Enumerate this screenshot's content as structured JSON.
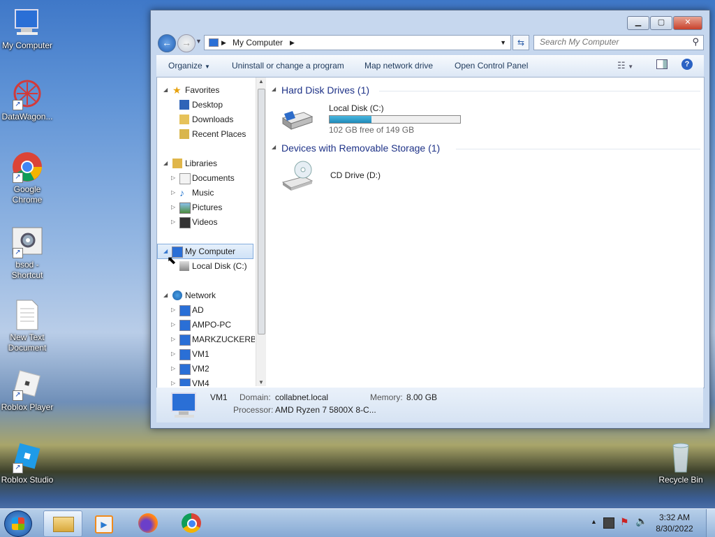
{
  "desktop": {
    "icons": [
      {
        "label": "My Computer"
      },
      {
        "label": "DataWagon..."
      },
      {
        "label": "Google Chrome"
      },
      {
        "label": "bsod - Shortcut"
      },
      {
        "label": "New Text Document"
      },
      {
        "label": "Roblox Player"
      },
      {
        "label": "Roblox Studio"
      },
      {
        "label": "Recycle Bin"
      }
    ]
  },
  "window": {
    "address": "My Computer",
    "search_placeholder": "Search My Computer",
    "toolbar": {
      "organize": "Organize",
      "uninstall": "Uninstall or change a program",
      "map_drive": "Map network drive",
      "control_panel": "Open Control Panel"
    },
    "nav": {
      "favorites": "Favorites",
      "desktop": "Desktop",
      "downloads": "Downloads",
      "recent": "Recent Places",
      "libraries": "Libraries",
      "documents": "Documents",
      "music": "Music",
      "pictures": "Pictures",
      "videos": "Videos",
      "my_computer": "My Computer",
      "local_disk": "Local Disk (C:)",
      "network": "Network",
      "net_items": [
        "AD",
        "AMPO-PC",
        "MARKZUCKERBE",
        "VM1",
        "VM2",
        "VM4"
      ]
    },
    "groups": {
      "hdd": "Hard Disk Drives (1)",
      "removable": "Devices with Removable Storage (1)"
    },
    "drives": {
      "c_name": "Local Disk (C:)",
      "c_free": "102 GB free of 149 GB",
      "c_used_fraction": 0.32,
      "d_name": "CD Drive (D:)"
    },
    "details": {
      "name": "VM1",
      "domain_label": "Domain:",
      "domain": "collabnet.local",
      "memory_label": "Memory:",
      "memory": "8.00 GB",
      "processor_label": "Processor:",
      "processor": "AMD Ryzen 7 5800X 8-C..."
    }
  },
  "taskbar": {
    "time": "3:32 AM",
    "date": "8/30/2022"
  }
}
